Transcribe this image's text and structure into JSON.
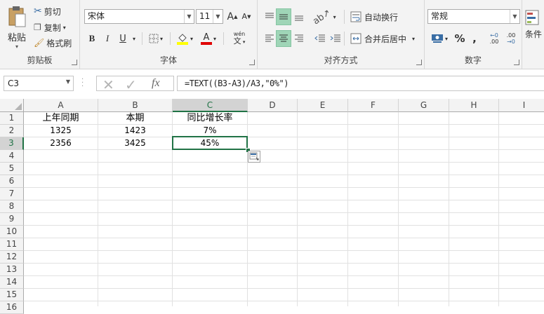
{
  "clipboard": {
    "paste": "粘贴",
    "cut": "剪切",
    "copy": "复制",
    "format_painter": "格式刷",
    "group": "剪贴板"
  },
  "font": {
    "name": "宋体",
    "size": "11",
    "bold": "B",
    "italic": "I",
    "underline": "U",
    "grow": "A",
    "shrink": "A",
    "phonetic_top": "wén",
    "phonetic_bottom": "文",
    "group": "字体"
  },
  "alignment": {
    "wrap": "自动换行",
    "merge": "合并后居中",
    "group": "对齐方式"
  },
  "number": {
    "format": "常规",
    "percent": "%",
    "comma": ",",
    "inc_decimal": ".00",
    "dec_decimal": ".00",
    "group": "数字"
  },
  "styles": {
    "conditional": "条件"
  },
  "formula_bar": {
    "name_box": "C3",
    "fx": "fx",
    "formula": "=TEXT((B3-A3)/A3,\"0%\")"
  },
  "sheet": {
    "columns": [
      "A",
      "B",
      "C",
      "D",
      "E",
      "F",
      "G",
      "H",
      "I"
    ],
    "rows": [
      "1",
      "2",
      "3",
      "4",
      "5",
      "6",
      "7",
      "8",
      "9",
      "10",
      "11",
      "12",
      "13",
      "14",
      "15",
      "16"
    ],
    "cells": {
      "A1": "上年同期",
      "B1": "本期",
      "C1": "同比增长率",
      "A2": "1325",
      "B2": "1423",
      "C2": "7%",
      "A3": "2356",
      "B3": "3425",
      "C3": "45%"
    },
    "selected": "C3"
  },
  "colors": {
    "accent": "#217346",
    "selected_header": "#d3d3d3"
  }
}
